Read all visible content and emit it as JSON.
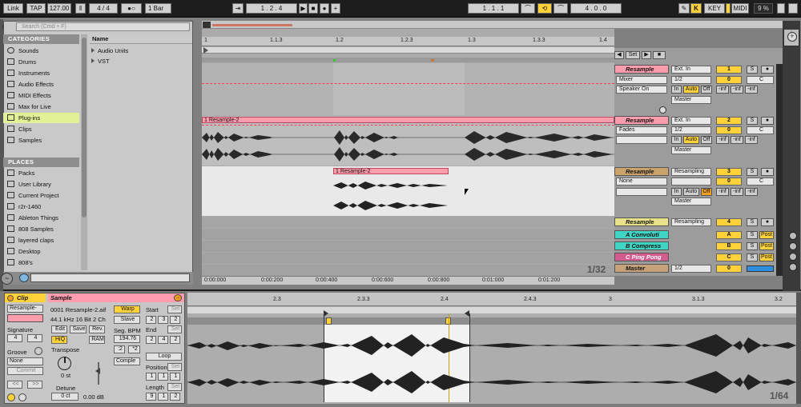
{
  "transport": {
    "link": "Link",
    "tap": "TAP",
    "tempo": "127.00",
    "signature": "4 / 4",
    "metronome": "●○",
    "quantize": "1 Bar",
    "position": "1 .   2 .   4",
    "loop_start": "1 .   1 .   1",
    "loop_length": "4 .   0 .   0",
    "key": "KEY",
    "midi": "MIDI",
    "cpu": "9 %"
  },
  "browser": {
    "search_placeholder": "Search (Cmd + F)",
    "categories_title": "CATEGORIES",
    "categories": [
      "Sounds",
      "Drums",
      "Instruments",
      "Audio Effects",
      "MIDI Effects",
      "Max for Live",
      "Plug-ins",
      "Clips",
      "Samples"
    ],
    "selected_category": "Plug-ins",
    "places_title": "PLACES",
    "places": [
      "Packs",
      "User Library",
      "Current Project",
      "r2r-1460",
      "Ableton Things",
      "808 Samples",
      "layered claps",
      "Desktop",
      "808's"
    ],
    "column_name": "Name",
    "items": [
      "Audio Units",
      "VST"
    ]
  },
  "arrangement": {
    "ruler": [
      "1",
      "1.1.3",
      "1.2",
      "1.2.3",
      "1.3",
      "1.3.3",
      "1.4"
    ],
    "time": [
      "0:00:000",
      "0:00:200",
      "0:00:400",
      "0:00:600",
      "0:00:800",
      "0:01:000",
      "0:01:200"
    ],
    "grid": "1/32",
    "set_label": "Set",
    "clips": {
      "track2": "1 Resample-2",
      "track3": "1 Resample-2"
    }
  },
  "tracks": [
    {
      "name": "Resample",
      "input": "Ext. In",
      "sub": "Mixer",
      "chan": "1/2",
      "mon": "Speaker On",
      "out": "Master",
      "num": "1",
      "vol": "0",
      "pan": "C",
      "color": "#ff9cae"
    },
    {
      "name": "Resample",
      "input": "Ext. In",
      "sub": "Fades",
      "chan": "1/2",
      "out": "Master",
      "num": "2",
      "vol": "0",
      "pan": "C",
      "color": "#ff9cae"
    },
    {
      "name": "Resample",
      "input": "Resampling",
      "sub": "None",
      "out": "Master",
      "num": "3",
      "vol": "0",
      "pan": "C",
      "color": "#c9a36a"
    },
    {
      "name": "Resample",
      "input": "Resampling",
      "num": "4",
      "color": "#e9e28a"
    },
    {
      "name": "A Convoluti",
      "num": "A",
      "color": "#3fd4c4",
      "send": "Post"
    },
    {
      "name": "B Compress",
      "num": "B",
      "color": "#3fd4c4",
      "send": "Post"
    },
    {
      "name": "C Ping Pong",
      "num": "C",
      "color": "#d35b8e",
      "send": "Post"
    },
    {
      "name": "Master",
      "chan": "1/2",
      "num": "0",
      "color": "#c8a27a"
    }
  ],
  "mixer_labels": {
    "in": "In",
    "auto": "Auto",
    "off": "Off",
    "inf": "-inf",
    "s": "S"
  },
  "clip": {
    "title": "Clip",
    "name": "Resample-",
    "signature_label": "Signature",
    "sig_num": "4",
    "sig_den": "4",
    "groove_label": "Groove",
    "groove": "None",
    "commit": "Commit"
  },
  "sample": {
    "title": "Sample",
    "file": "0001 Resample-2.aif",
    "info": "44.1 kHz 16 Bit 2 Ch",
    "edit": "Edit",
    "save": "Save",
    "rev": "Rev.",
    "hiq": "HiQ",
    "ram": "RAM",
    "transpose_label": "Transpose",
    "transpose": "0 st",
    "detune_label": "Detune",
    "detune": "0 ct",
    "gain": "0.00 dB",
    "warp": "Warp",
    "slave": "Slave",
    "seg_bpm_label": "Seg. BPM",
    "seg_bpm": "194.76",
    "half": ":2",
    "double": "*2",
    "mode": "Comple",
    "start_label": "Start",
    "start": [
      "2",
      "3",
      "2"
    ],
    "end_label": "End",
    "end": [
      "2",
      "4",
      "2"
    ],
    "loop": "Loop",
    "position_label": "Position",
    "position": [
      "1",
      "1",
      "1"
    ],
    "length_label": "Length",
    "length": [
      "9",
      "1",
      "2"
    ],
    "set": "Set"
  },
  "sample_editor": {
    "ruler": [
      "2.3",
      "2.3.3",
      "2.4",
      "2.4.3",
      "3",
      "3.1.3",
      "3.2"
    ],
    "grid": "1/64"
  }
}
